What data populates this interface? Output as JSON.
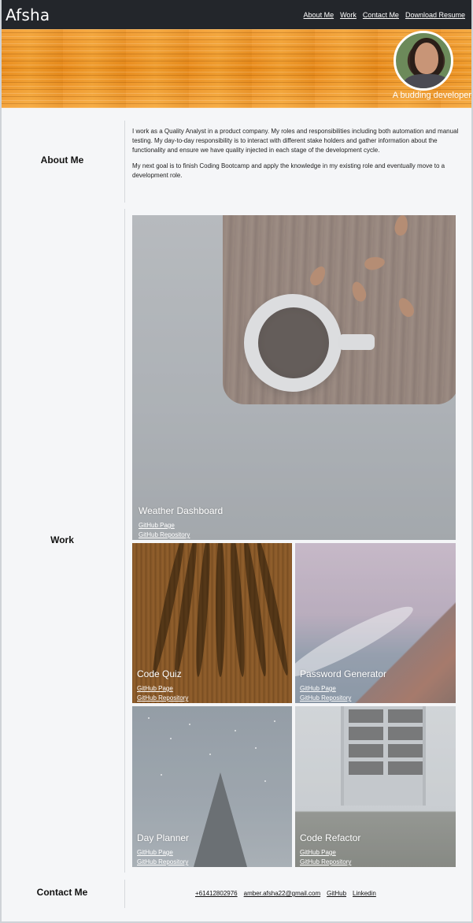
{
  "header": {
    "brand": "Afsha",
    "nav": [
      {
        "label": "About Me"
      },
      {
        "label": "Work"
      },
      {
        "label": "Contact Me"
      },
      {
        "label": "Download Resume"
      }
    ]
  },
  "banner": {
    "tagline": "A budding developer"
  },
  "about": {
    "heading": "About Me",
    "paragraphs": [
      "I work as a Quality Analyst in a product company. My roles and responsibilities including both automation and manual testing. My day-to-day responsibility is to interact with different stake holders and gather information about the functionality and ensure we have quality injected in each stage of the development cycle.",
      "My next goal is to finish Coding Bootcamp and apply the knowledge in my existing role and eventually move to a development role."
    ]
  },
  "work": {
    "heading": "Work",
    "projects": [
      {
        "title": "Weather Dashboard",
        "page_label": "GitHub Page",
        "repo_label": "GitHub Repository"
      },
      {
        "title": "Code Quiz",
        "page_label": "GitHub Page",
        "repo_label": "GitHub Repository"
      },
      {
        "title": "Password Generator",
        "page_label": "GitHub Page",
        "repo_label": "GitHub Repository"
      },
      {
        "title": "Day Planner",
        "page_label": "GitHub Page",
        "repo_label": "GitHub Repository"
      },
      {
        "title": "Code Refactor",
        "page_label": "GitHub Page",
        "repo_label": "GitHub Repository"
      }
    ]
  },
  "contact": {
    "heading": "Contact Me",
    "links": [
      {
        "label": "+61412802976"
      },
      {
        "label": "amber.afsha22@gmail.com"
      },
      {
        "label": "GitHub"
      },
      {
        "label": "Linkedin"
      }
    ]
  },
  "colors": {
    "navbar": "#23262b",
    "banner": "#e88b1c",
    "page_background": "#f5f6f8"
  }
}
